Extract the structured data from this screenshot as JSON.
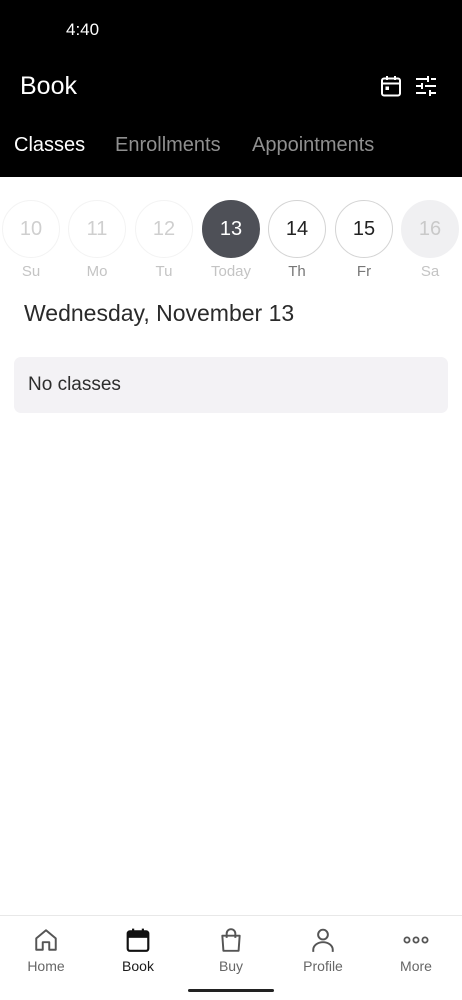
{
  "status_bar": {
    "time": "4:40"
  },
  "header": {
    "title": "Book",
    "calendar_icon": "calendar-icon",
    "filter_icon": "tune-icon"
  },
  "tabs": [
    {
      "label": "Classes",
      "active": true
    },
    {
      "label": "Enrollments",
      "active": false
    },
    {
      "label": "Appointments",
      "active": false
    }
  ],
  "days": [
    {
      "number": "10",
      "label": "Su",
      "state": "past"
    },
    {
      "number": "11",
      "label": "Mo",
      "state": "past"
    },
    {
      "number": "12",
      "label": "Tu",
      "state": "past"
    },
    {
      "number": "13",
      "label": "Today",
      "state": "today"
    },
    {
      "number": "14",
      "label": "Th",
      "state": "future"
    },
    {
      "number": "15",
      "label": "Fr",
      "state": "future"
    },
    {
      "number": "16",
      "label": "Sa",
      "state": "disabled"
    }
  ],
  "selected_date": "Wednesday, November 13",
  "empty_message": "No classes",
  "bottom_nav": [
    {
      "label": "Home",
      "icon": "home-icon",
      "active": false
    },
    {
      "label": "Book",
      "icon": "calendar-icon",
      "active": true
    },
    {
      "label": "Buy",
      "icon": "shopping-bag-icon",
      "active": false
    },
    {
      "label": "Profile",
      "icon": "person-icon",
      "active": false
    },
    {
      "label": "More",
      "icon": "more-dots-icon",
      "active": false
    }
  ],
  "colors": {
    "header_bg": "#000000",
    "today_circle": "#4e5057",
    "card_bg": "#f3f2f5"
  }
}
